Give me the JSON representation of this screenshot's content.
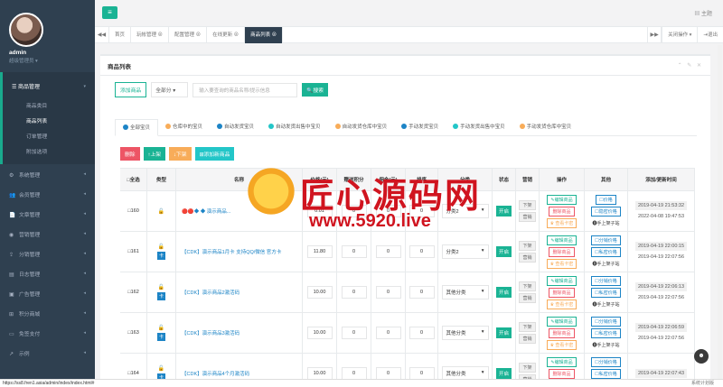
{
  "sidebar": {
    "user_name": "admin",
    "user_role": "超级管理员 ▾",
    "group_label": "商品管理",
    "sub_items": [
      "商品类目",
      "商品列表",
      "订单管理",
      "附加选项"
    ],
    "items": [
      {
        "label": "系统管理",
        "icon": "gear-icon",
        "glyph": "⚙"
      },
      {
        "label": "会员管理",
        "icon": "users-icon",
        "glyph": "👥"
      },
      {
        "label": "文章管理",
        "icon": "doc-icon",
        "glyph": "📄"
      },
      {
        "label": "营销管理",
        "icon": "globe-icon",
        "glyph": "◉"
      },
      {
        "label": "分销管理",
        "icon": "share-icon",
        "glyph": "⇪"
      },
      {
        "label": "日志管理",
        "icon": "log-icon",
        "glyph": "▤"
      },
      {
        "label": "广告管理",
        "icon": "ad-icon",
        "glyph": "▣"
      },
      {
        "label": "积分商城",
        "icon": "shop-icon",
        "glyph": "⊞"
      },
      {
        "label": "免签支付",
        "icon": "pay-icon",
        "glyph": "▭"
      },
      {
        "label": "示例",
        "icon": "chart-icon",
        "glyph": "↗"
      }
    ]
  },
  "topbar": {
    "theme_label": "▤ 主题",
    "menu_glyph": "≡"
  },
  "tabs": {
    "items": [
      "首页",
      "玩帐管理 ⊗",
      "配置管理 ⊗",
      "在线更新 ⊗",
      "商品列表 ⊗"
    ],
    "right_ops": "关闭操作 ▾",
    "right_exit": "⇥退出"
  },
  "panel": {
    "title": "商品列表",
    "tools": "⌃ ✎ ✕"
  },
  "toolbar": {
    "add_label": "添加商品",
    "filter_value": "全部分 ▾",
    "search_placeholder": "输入要查询的商品名称/提示信息",
    "search_label": "搜索"
  },
  "category_tabs": [
    {
      "label": "全部宝贝",
      "color": "#1c84c6"
    },
    {
      "label": "仓库中的宝贝",
      "color": "#f8ac59"
    },
    {
      "label": "自动发货宝贝",
      "color": "#1c84c6"
    },
    {
      "label": "自动发货出售中宝贝",
      "color": "#23c6c8"
    },
    {
      "label": "自动发货仓库中宝贝",
      "color": "#f8ac59"
    },
    {
      "label": "手动发货宝贝",
      "color": "#1c84c6"
    },
    {
      "label": "手动发货出售中宝贝",
      "color": "#23c6c8"
    },
    {
      "label": "手动发货仓库中宝贝",
      "color": "#f8ac59"
    }
  ],
  "actions": [
    {
      "label": "删除",
      "color": "#ed5565"
    },
    {
      "label": "↑上架",
      "color": "#1ab394"
    },
    {
      "label": "↓下架",
      "color": "#f8ac59"
    },
    {
      "label": "⊞添加新商品",
      "color": "#23c6c8"
    }
  ],
  "table": {
    "headers": [
      "□全选",
      "类型",
      "名称",
      "价格(元)",
      "赠送积分",
      "佣金(元)",
      "排序",
      "分类",
      "状态",
      "营销",
      "操作",
      "其他",
      "添加/更新时间"
    ],
    "rows": [
      {
        "id": "□160",
        "name": "🔴🔴◆ ◆ 演示商品...",
        "price": "0.01",
        "points": "0",
        "commission": "0",
        "sort": "0",
        "category": "分类2",
        "status": "开启",
        "m1": "下架",
        "m2": "营销",
        "ops": [
          "✎编辑商品",
          "删除商品",
          "♛ 查看卡密"
        ],
        "other": [
          "☐价格",
          "☐隐密价格",
          "⓿手上架子站"
        ],
        "t1": "2019-04-19 21:53:32",
        "t2": "2022-04-08 19:47:53",
        "kami": false
      },
      {
        "id": "□161",
        "name": "【CDK】演示商品1月卡 支持QQ/微信 官方卡",
        "price": "11.80",
        "points": "0",
        "commission": "0",
        "sort": "0",
        "category": "分类2",
        "status": "开启",
        "m1": "下架",
        "m2": "营销",
        "ops": [
          "✎编辑商品",
          "删除商品",
          "♛ 查看卡密"
        ],
        "other": [
          "☐分销价格",
          "☐私密价格",
          "⓿手上架子站"
        ],
        "t1": "2019-04-19 22:00:15",
        "t2": "2019-04-19 22:07:56",
        "kami": true
      },
      {
        "id": "□162",
        "name": "【CDK】演示商品2激活码",
        "price": "10.00",
        "points": "0",
        "commission": "0",
        "sort": "0",
        "category": "其他分类",
        "status": "开启",
        "m1": "下架",
        "m2": "营销",
        "ops": [
          "✎编辑商品",
          "删除商品",
          "♛ 查看卡密"
        ],
        "other": [
          "☐分销价格",
          "☐私密价格",
          "⓿手上架子站"
        ],
        "t1": "2019-04-19 22:06:13",
        "t2": "2019-04-19 22:07:56",
        "kami": true
      },
      {
        "id": "□163",
        "name": "【CDK】演示商品3激活码",
        "price": "10.00",
        "points": "0",
        "commission": "0",
        "sort": "0",
        "category": "其他分类",
        "status": "开启",
        "m1": "下架",
        "m2": "营销",
        "ops": [
          "✎编辑商品",
          "删除商品",
          "♛ 查看卡密"
        ],
        "other": [
          "☐分销价格",
          "☐私密价格",
          "⓿手上架子站"
        ],
        "t1": "2019-04-19 22:06:59",
        "t2": "2019-04-19 22:07:56",
        "kami": true
      },
      {
        "id": "□164",
        "name": "【CDK】演示商品4个月激活码",
        "price": "10.00",
        "points": "0",
        "commission": "0",
        "sort": "0",
        "category": "其他分类",
        "status": "开启",
        "m1": "下架",
        "m2": "营销",
        "ops": [
          "✎编辑商品",
          "删除商品",
          "♛ 查看卡密"
        ],
        "other": [
          "☐分销价格",
          "☐私密价格",
          "⓿手上架子站"
        ],
        "t1": "2019-04-19 22:07:43",
        "t2": "",
        "kami": true
      }
    ]
  },
  "watermark": {
    "title": "匠心源码网",
    "url": "www.5920.live"
  },
  "statusbar": {
    "url": "https://ss8.fren1.asia/admin/index/index.html#",
    "right": "系统计划版"
  }
}
